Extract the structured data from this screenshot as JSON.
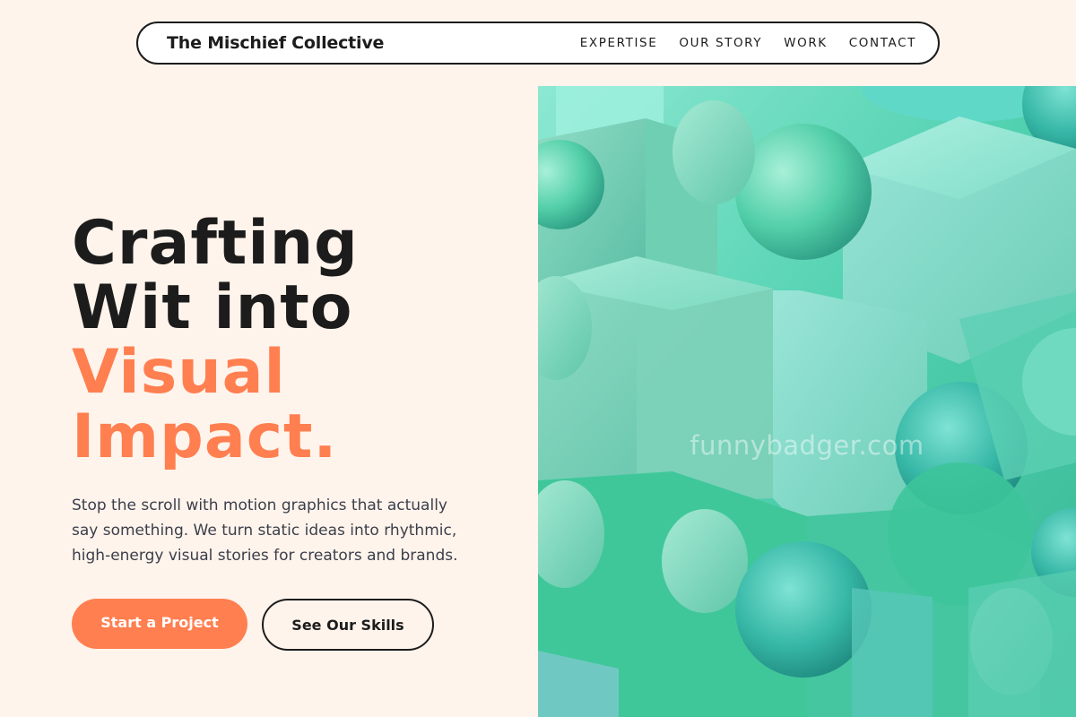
{
  "nav": {
    "brand": "The Mischief Collective",
    "links": [
      "EXPERTISE",
      "OUR STORY",
      "WORK",
      "CONTACT"
    ]
  },
  "hero": {
    "headline_line1": "Crafting",
    "headline_line2": "Wit into",
    "headline_accent1": "Visual",
    "headline_accent2": "Impact.",
    "description": "Stop the scroll with motion graphics that actually say something. We turn static ideas into rhythmic, high-energy visual stories for creators and brands.",
    "primary_cta": "Start a Project",
    "secondary_cta": "See Our Skills"
  },
  "image": {
    "watermark": "funnybadger.com"
  },
  "colors": {
    "background": "#fff4ec",
    "accent": "#ff7f50",
    "text": "#1c1c1c",
    "art_mint": "#5fd4b4"
  }
}
